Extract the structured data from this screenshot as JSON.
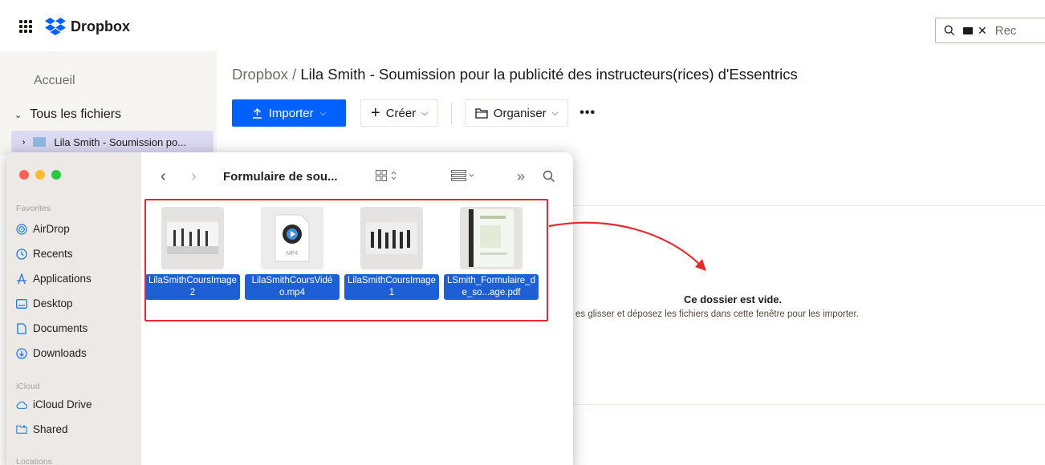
{
  "app": {
    "name": "Dropbox",
    "search_value": "Rec"
  },
  "leftnav": {
    "home": "Accueil",
    "all_files": "Tous les fichiers",
    "selected_folder": "Lila Smith - Soumission po..."
  },
  "main": {
    "breadcrumb_root": "Dropbox",
    "breadcrumb_sep": " / ",
    "breadcrumb_current": "Lila Smith - Soumission pour la publicité des instructeurs(rices) d'Essentrics",
    "toolbar": {
      "import": "Importer",
      "create": "Créer",
      "organize": "Organiser",
      "more": "•••"
    },
    "empty_title": "Ce dossier est vide.",
    "empty_sub": "es glisser et déposez les fichiers dans cette fenêtre pour les importer."
  },
  "finder": {
    "title": "Formulaire de sou...",
    "sections": {
      "favorites": "Favorites",
      "icloud": "iCloud",
      "locations": "Locations"
    },
    "favorites": [
      "AirDrop",
      "Recents",
      "Applications",
      "Desktop",
      "Documents",
      "Downloads"
    ],
    "icloud_items": [
      "iCloud Drive",
      "Shared"
    ],
    "files": [
      {
        "name": "LilaSmithCoursImage2",
        "kind": "image"
      },
      {
        "name": "LilaSmithCoursVidéo.mp4",
        "kind": "video",
        "badge": "MP4"
      },
      {
        "name": "LilaSmithCoursImage1",
        "kind": "image"
      },
      {
        "name": "LSmith_Formulaire_de_so...age.pdf",
        "kind": "pdf"
      }
    ]
  },
  "colors": {
    "dropbox_blue": "#0061fe",
    "selection_blue": "#1f5fd6",
    "annotation_red": "#e8282b"
  }
}
